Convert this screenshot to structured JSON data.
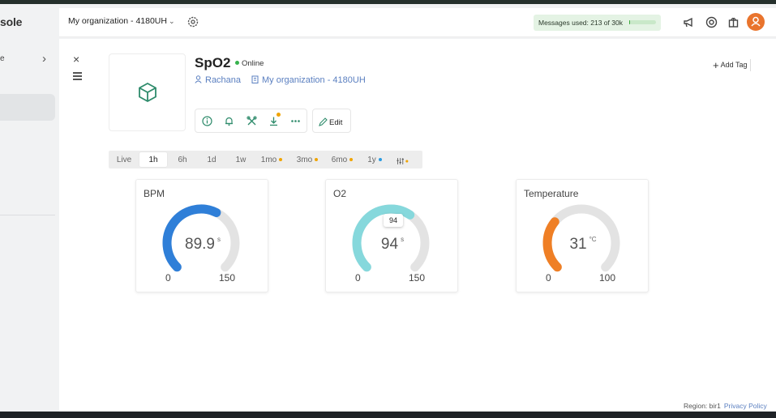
{
  "sidebar": {
    "brand": "sole",
    "item_label": "e",
    "chevron": "›"
  },
  "header": {
    "org_selector": "My organization - 4180UH",
    "messages_used": "Messages used: 213 of 30k",
    "messages_fraction": 0.0071,
    "icons": [
      "gear-icon",
      "megaphone-icon",
      "support-icon",
      "gift-icon",
      "user-icon"
    ]
  },
  "device": {
    "name": "SpO2",
    "status": "Online",
    "owner": "Rachana",
    "organization": "My organization - 4180UH",
    "add_tag": "Add Tag",
    "edit": "Edit",
    "close": "×",
    "plus": "+"
  },
  "ranges": [
    {
      "label": "Live",
      "active": false,
      "dot": ""
    },
    {
      "label": "1h",
      "active": true,
      "dot": ""
    },
    {
      "label": "6h",
      "active": false,
      "dot": ""
    },
    {
      "label": "1d",
      "active": false,
      "dot": ""
    },
    {
      "label": "1w",
      "active": false,
      "dot": ""
    },
    {
      "label": "1mo",
      "active": false,
      "dot": "#f0a400"
    },
    {
      "label": "3mo",
      "active": false,
      "dot": "#f0a400"
    },
    {
      "label": "6mo",
      "active": false,
      "dot": "#f0a400"
    },
    {
      "label": "1y",
      "active": false,
      "dot": "#2b9be0"
    }
  ],
  "filter_dot": "#f0a400",
  "gauges": [
    {
      "title": "BPM",
      "value": "89.9",
      "unit": "s",
      "min": "0",
      "max": "150",
      "fraction": 0.599,
      "color": "#2f7fd8",
      "tooltip": ""
    },
    {
      "title": "O2",
      "value": "94",
      "unit": "s",
      "min": "0",
      "max": "150",
      "fraction": 0.627,
      "color": "#86d8dc",
      "tooltip": "94"
    },
    {
      "title": "Temperature",
      "value": "31",
      "unit": "°C",
      "min": "0",
      "max": "100",
      "fraction": 0.31,
      "color": "#ef7f25",
      "tooltip": ""
    }
  ],
  "footer": {
    "region": "Region: bir1",
    "privacy": "Privacy Policy"
  }
}
